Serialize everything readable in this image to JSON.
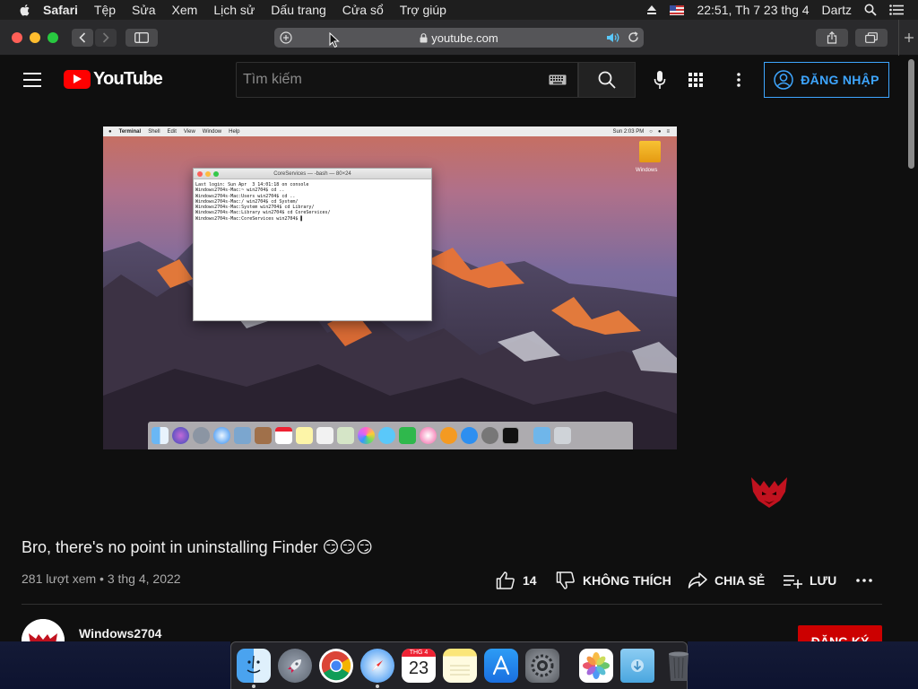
{
  "menubar": {
    "app": "Safari",
    "items": [
      "Tệp",
      "Sửa",
      "Xem",
      "Lịch sử",
      "Dấu trang",
      "Cửa sổ",
      "Trợ giúp"
    ],
    "clock": "22:51, Th 7 23 thg 4",
    "user": "Dartz"
  },
  "browser": {
    "url": "youtube.com"
  },
  "youtube": {
    "logo_text": "YouTube",
    "search_placeholder": "Tìm kiếm",
    "signin_label": "ĐĂNG NHẬP"
  },
  "video_frame": {
    "menubar": [
      "Terminal",
      "Shell",
      "Edit",
      "View",
      "Window",
      "Help"
    ],
    "clock": "Sun 2:03 PM",
    "desktop_icon_label": "Windows",
    "terminal_title": "CoreServices — -bash — 80×24",
    "terminal_lines": [
      "Last login: Sun Apr  3 14:01:18 on console",
      "Windows2704s-Mac:~ win2704$ cd ..",
      "Windows2704s-Mac:Users win2704$ cd ..",
      "Windows2704s-Mac:/ win2704$ cd System/",
      "Windows2704s-Mac:System win2704$ cd Library/",
      "Windows2704s-Mac:Library win2704$ cd CoreServices/",
      "Windows2704s-Mac:CoreServices win2704$ ▌"
    ]
  },
  "video": {
    "title": "Bro, there's no point in uninstalling Finder 😏😏😏",
    "meta": "281 lượt xem • 3 thg 4, 2022",
    "likes": "14",
    "dislike_label": "KHÔNG THÍCH",
    "share_label": "CHIA SẺ",
    "save_label": "LƯU"
  },
  "channel": {
    "name": "Windows2704",
    "subscribe_label": "ĐĂNG KÝ"
  },
  "dock": {
    "calendar_month": "THG 4",
    "calendar_day": "23"
  },
  "colors": {
    "youtube_red": "#ff0000",
    "link_blue": "#3ea6ff",
    "subscribe_red": "#cc0000",
    "background": "#0f0f0f"
  }
}
